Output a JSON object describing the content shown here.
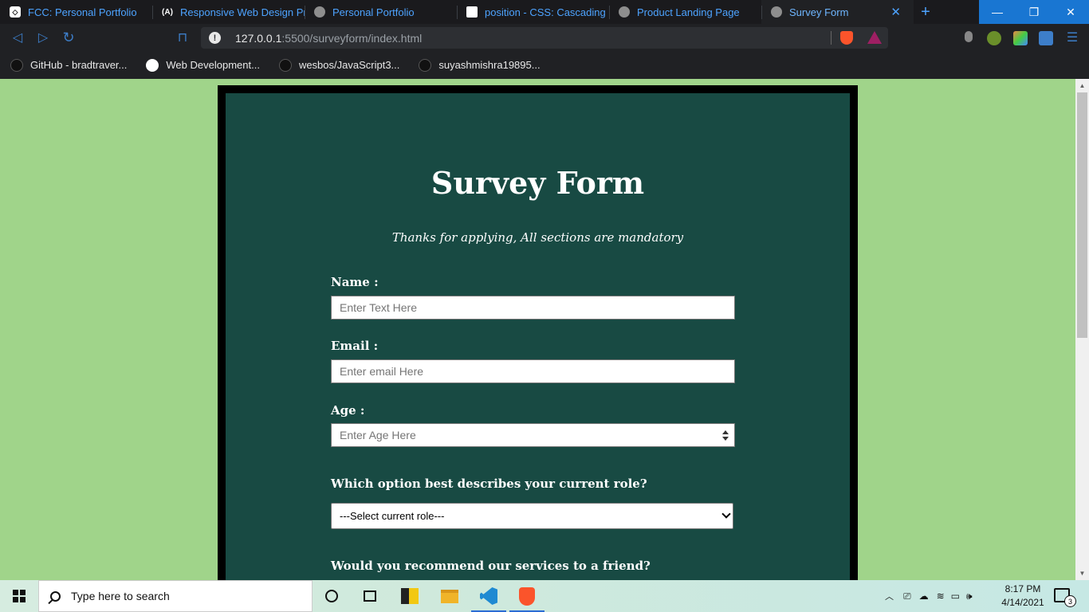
{
  "browser": {
    "tabs": [
      {
        "title": "FCC: Personal Portfolio",
        "icon": "codepen-icon"
      },
      {
        "title": "Responsive Web Design Proj",
        "icon": "freecodecamp-icon"
      },
      {
        "title": "Personal Portfolio",
        "icon": "globe-icon"
      },
      {
        "title": "position - CSS: Cascading Sty",
        "icon": "mdn-icon"
      },
      {
        "title": "Product Landing Page",
        "icon": "globe-icon"
      },
      {
        "title": "Survey Form",
        "icon": "globe-icon",
        "active": true
      }
    ],
    "url_host": "127.0.0.1",
    "url_rest": ":5500/surveyform/index.html",
    "bookmarks": [
      {
        "label": "GitHub - bradtraver...",
        "icon": "github-icon"
      },
      {
        "label": "Web Development...",
        "icon": "bookmark-favicon-icon"
      },
      {
        "label": "wesbos/JavaScript3...",
        "icon": "github-icon"
      },
      {
        "label": "suyashmishra19895...",
        "icon": "github-icon"
      }
    ]
  },
  "page": {
    "title": "Survey Form",
    "description": "Thanks for applying, All sections are mandatory",
    "name": {
      "label": "Name :",
      "placeholder": "Enter Text Here"
    },
    "email": {
      "label": "Email :",
      "placeholder": "Enter email Here"
    },
    "age": {
      "label": "Age :",
      "placeholder": "Enter Age Here"
    },
    "role": {
      "question": "Which option best describes your current role?",
      "selected": "---Select current role---"
    },
    "recommend": {
      "question": "Would you recommend our services to a friend?"
    }
  },
  "taskbar": {
    "search_placeholder": "Type here to search",
    "time": "8:17 PM",
    "date": "4/14/2021",
    "notification_count": "3"
  },
  "colors": {
    "page_bg": "#a0d48a",
    "card_bg": "#184a43",
    "accent": "#1976d2"
  }
}
